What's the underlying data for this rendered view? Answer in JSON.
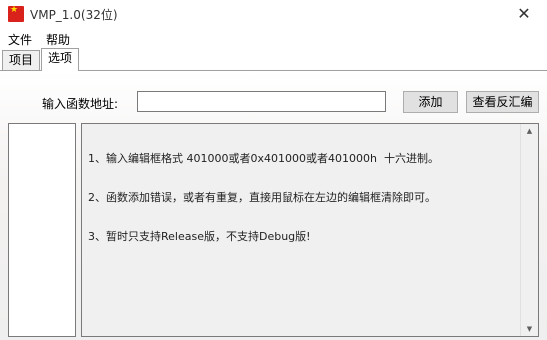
{
  "window": {
    "title": "VMP_1.0(32位)",
    "close": "✕"
  },
  "menu": [
    "文件",
    "帮助"
  ],
  "tabs": [
    "项目",
    "选项"
  ],
  "form": {
    "address_label": "输入函数地址:",
    "address_value": "",
    "add_button": "添加",
    "disasm_button": "查看反汇编"
  },
  "info_lines": [
    "1、输入编辑框格式 401000或者0x401000或者401000h  十六进制。",
    "2、函数添加错误，或者有重复，直接用鼠标在左边的编辑框清除即可。",
    "3、暂时只支持Release版，不支持Debug版!"
  ],
  "colors": {
    "icon_bg": "#d9221c",
    "icon_star": "#ffde00",
    "button_bg": "#e1e1e1"
  }
}
